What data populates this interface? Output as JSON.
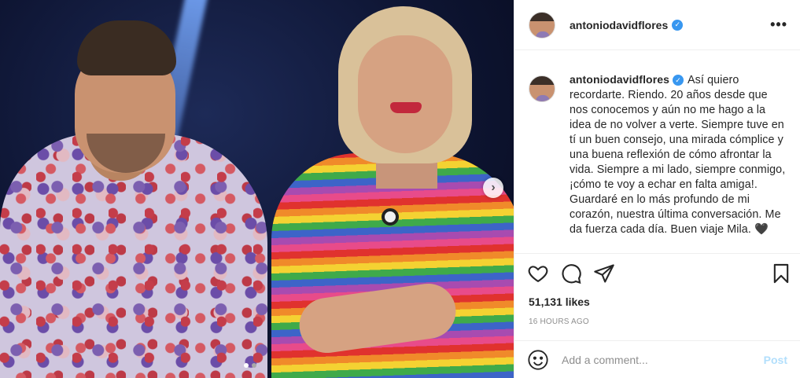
{
  "post": {
    "username": "antoniodavidflores",
    "verified_icon": "verified-badge-icon",
    "more_icon": "more-options-icon",
    "caption": "Así quiero recordarte. Riendo. 20 años desde que nos conocemos y aún no me hago a la idea de no volver a verte. Siempre tuve en tí un buen consejo, una mirada cómplice y una buena reflexión de cómo afrontar la vida. Siempre a mi lado, siempre conmigo, ¡cómo te voy a echar en falta amiga!. Guardaré en lo más profundo de mi corazón, nuestra última conversación. Me da fuerza cada día. Buen viaje Mila. 🖤",
    "likes": "51,131 likes",
    "timestamp": "16 HOURS AGO",
    "carousel": {
      "total_slides": 2,
      "active_slide": 1
    }
  },
  "comment_box": {
    "placeholder": "Add a comment...",
    "post_label": "Post"
  },
  "colors": {
    "verified": "#3897f0",
    "post_button": "#b2dffc",
    "muted_text": "#8e8e8e"
  }
}
